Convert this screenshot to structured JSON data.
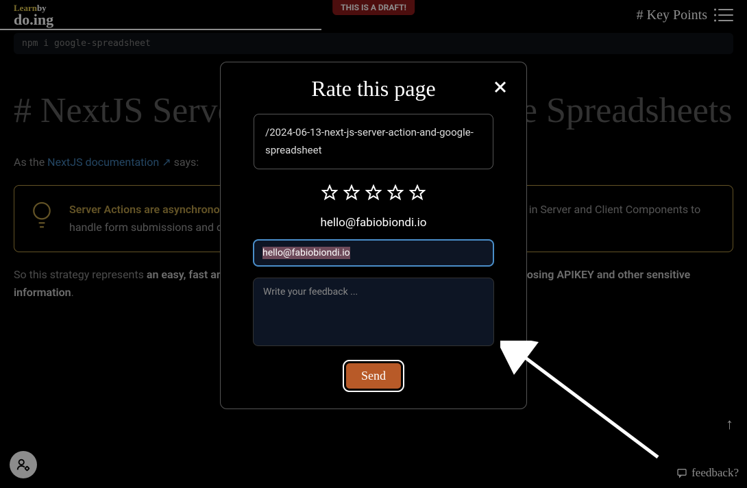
{
  "header": {
    "logo_top_learn": "Learn",
    "logo_top_by": "by",
    "logo_bottom": "do.ing",
    "draft_badge": "THIS IS A DRAFT!",
    "keypoints": "# Key Points"
  },
  "bg": {
    "code_line": "npm i google-spreadsheet",
    "title": "# NextJS Server Actions and Google Spreadsheets",
    "as_the": "As the ",
    "doclink": "NextJS documentation",
    "says": " says:",
    "callout_em": "Server Actions are asynchronous functions that are executed on the server",
    "callout_rest": ". They can be used in Server and Client Components to handle form submissions and data mutations in Next.js applications.",
    "summary_pre": "So this strategy represents ",
    "summary_em": "an easy, fast and safe way to implement my code with the certainty of not exposing APIKEY and other sensitive information",
    "summary_end": "."
  },
  "modal": {
    "title": "Rate this page",
    "url": "/2024-06-13-next-js-server-action-and-google-spreadsheet",
    "email_label": "hello@fabiobiondi.io",
    "email_value": "hello@fabiobiondi.io",
    "feedback_placeholder": "Write your feedback ...",
    "send": "Send"
  },
  "fab": {
    "feedback": "feedback?"
  }
}
